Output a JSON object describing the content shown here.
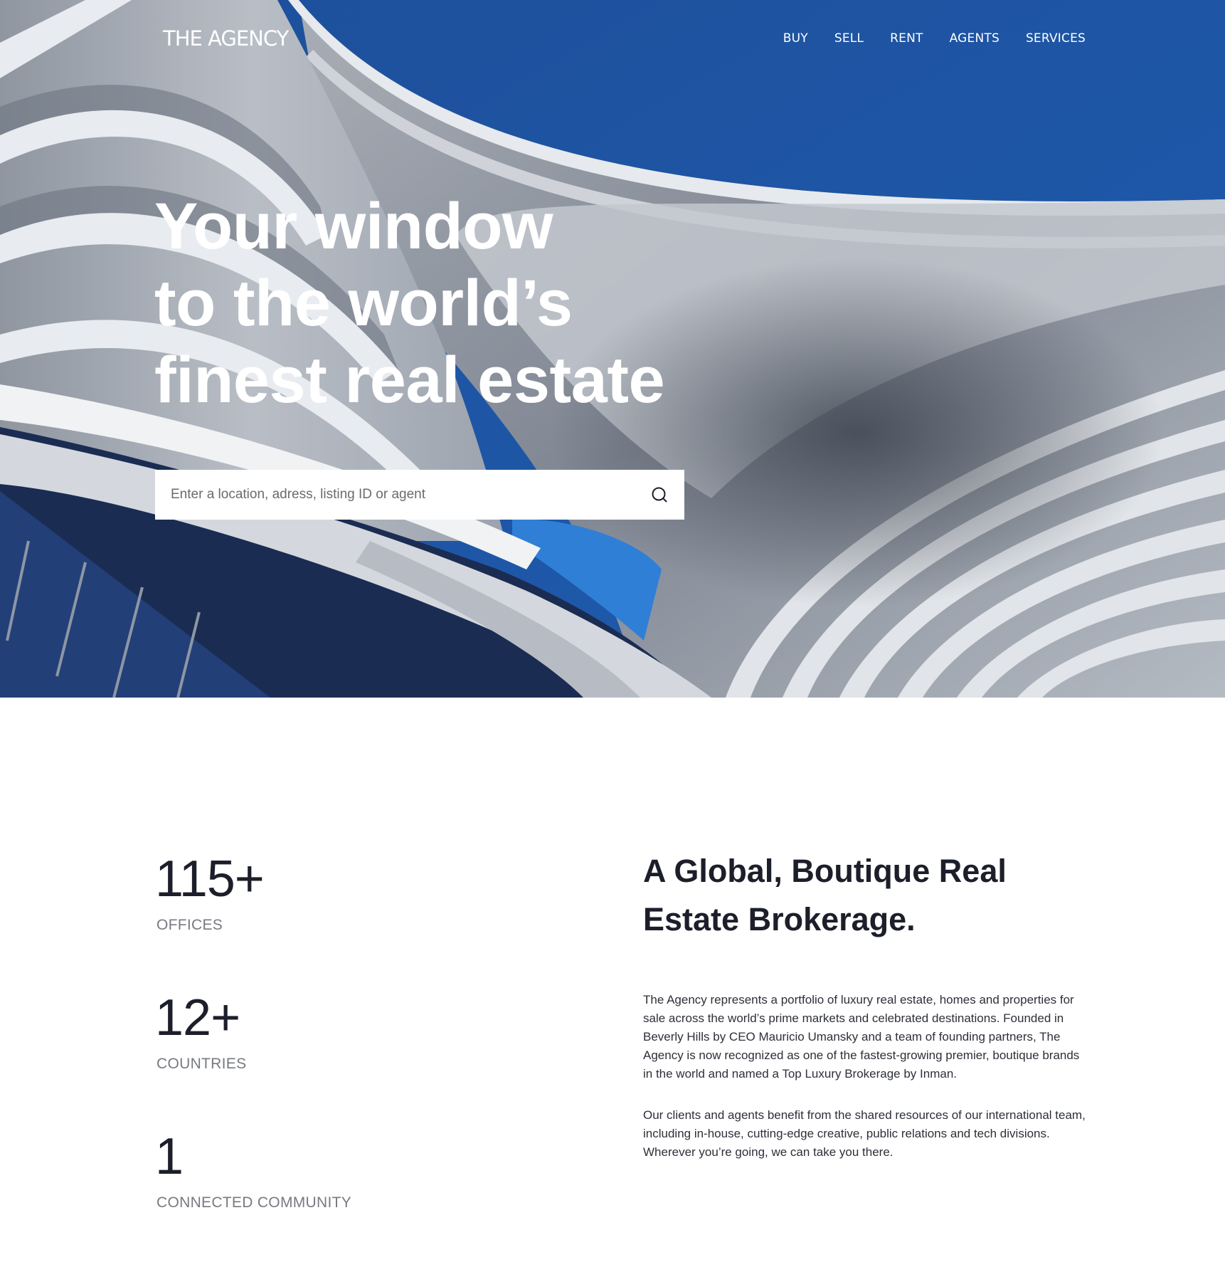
{
  "brand": {
    "logo_text": "THE AGENCY"
  },
  "nav": {
    "items": [
      {
        "label": "BUY"
      },
      {
        "label": "SELL"
      },
      {
        "label": "RENT"
      },
      {
        "label": "AGENTS"
      },
      {
        "label": "SERVICES"
      }
    ]
  },
  "hero": {
    "title_lines": [
      "Your window",
      "to the world’s",
      "finest real estate"
    ]
  },
  "search": {
    "placeholder": "Enter a location, adress, listing ID or agent",
    "value": ""
  },
  "stats": [
    {
      "value": "115+",
      "label": "OFFICES"
    },
    {
      "value": "12+",
      "label": "COUNTRIES"
    },
    {
      "value": "1",
      "label": "CONNECTED COMMUNITY"
    }
  ],
  "about": {
    "heading": "A Global, Boutique Real Estate Brokerage.",
    "paragraph_1": "The Agency represents a portfolio of luxury real estate, homes and properties for sale across the world’s prime markets and celebrated destinations. Founded in Beverly Hills by CEO Mauricio Umansky and a team of founding partners, The Agency is now recognized as one of the fastest-growing premier, boutique brands in the world and named a Top Luxury Brokerage by Inman.",
    "paragraph_2": "Our clients and agents benefit from the shared resources of our international team, including in-house, cutting-edge creative, public relations and tech divisions. Wherever you’re going, we can take you there."
  },
  "colors": {
    "sky": "#1c56a6",
    "facade_light": "#d9dde3",
    "facade_mid": "#9aa1ab",
    "text_dark": "#1c1f2a",
    "text_muted": "#777a80"
  },
  "icons": {
    "search": "search-icon"
  }
}
